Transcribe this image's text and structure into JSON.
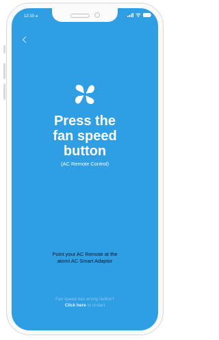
{
  "status_bar": {
    "time": "12:10 ◂"
  },
  "icons": {
    "back": "chevron-left-icon",
    "fan": "fan-icon"
  },
  "main": {
    "title_line1": "Press the",
    "title_line2": "fan speed",
    "title_line3": "button",
    "subtitle": "(AC Remote Control)",
    "instruction_line1": "Point your AC Remote at the",
    "instruction_line2": "atomi AC Smart Adaptor"
  },
  "footer": {
    "question": "Fan speed has wrong button?",
    "link": "Click here",
    "after_link": " to restart"
  },
  "colors": {
    "screen_background": "#2f9ee3",
    "title": "#ffffff",
    "instruction": "#0d1a2a",
    "footer": "#8cc9f1"
  }
}
